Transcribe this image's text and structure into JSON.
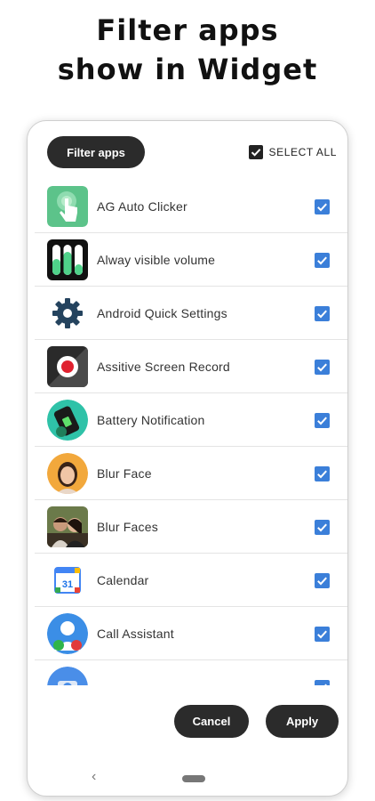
{
  "headline": {
    "line1": "Filter apps",
    "line2": "show in Widget"
  },
  "toolbar": {
    "filter_label": "Filter apps",
    "select_all_label": "SELECT ALL"
  },
  "apps": [
    {
      "label": "AG Auto Clicker",
      "icon": "tap-hand-icon",
      "checked": true
    },
    {
      "label": "Alway visible volume",
      "icon": "volume-bars-icon",
      "checked": true
    },
    {
      "label": "Android Quick Settings",
      "icon": "gear-icon",
      "checked": true
    },
    {
      "label": "Assitive Screen Record",
      "icon": "record-icon",
      "checked": true
    },
    {
      "label": "Battery Notification",
      "icon": "battery-icon",
      "checked": true
    },
    {
      "label": "Blur Face",
      "icon": "face-photo-icon",
      "checked": true
    },
    {
      "label": "Blur Faces",
      "icon": "couple-photo-icon",
      "checked": true
    },
    {
      "label": "Calendar",
      "icon": "calendar-icon",
      "calendar_day": "31",
      "checked": true
    },
    {
      "label": "Call Assistant",
      "icon": "call-assistant-icon",
      "checked": true
    },
    {
      "label": "",
      "icon": "camera-icon",
      "checked": true
    }
  ],
  "actions": {
    "cancel_label": "Cancel",
    "apply_label": "Apply"
  },
  "navigation": {
    "back_glyph": "‹"
  },
  "colors": {
    "accent": "#3b7fd9",
    "pill": "#2b2b2b"
  }
}
